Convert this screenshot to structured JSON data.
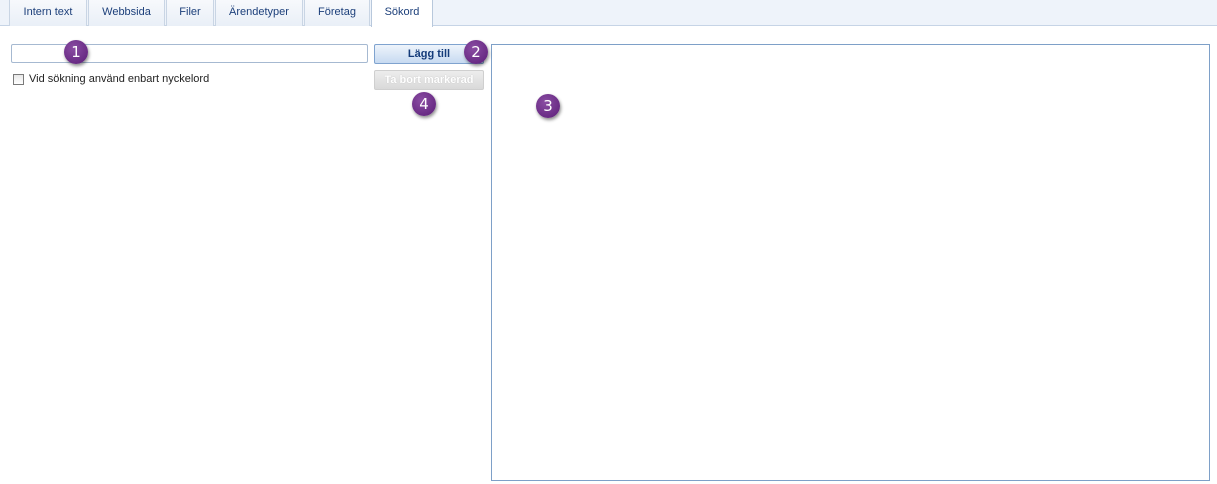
{
  "tabs": [
    {
      "label": "Intern text",
      "active": false
    },
    {
      "label": "Webbsida",
      "active": false
    },
    {
      "label": "Filer",
      "active": false
    },
    {
      "label": "Ärendetyper",
      "active": false
    },
    {
      "label": "Företag",
      "active": false
    },
    {
      "label": "Sökord",
      "active": true
    }
  ],
  "keyword_input": {
    "value": "",
    "placeholder": ""
  },
  "checkbox": {
    "label": "Vid sökning använd enbart nyckelord",
    "checked": false
  },
  "buttons": {
    "add_label": "Lägg till",
    "remove_label": "Ta bort markerad",
    "remove_enabled": false
  },
  "markers": [
    "1",
    "2",
    "3",
    "4"
  ],
  "colors": {
    "accent": "#5b1d77",
    "tab_text": "#1c3f7a",
    "list_border": "#7ea0c8"
  }
}
